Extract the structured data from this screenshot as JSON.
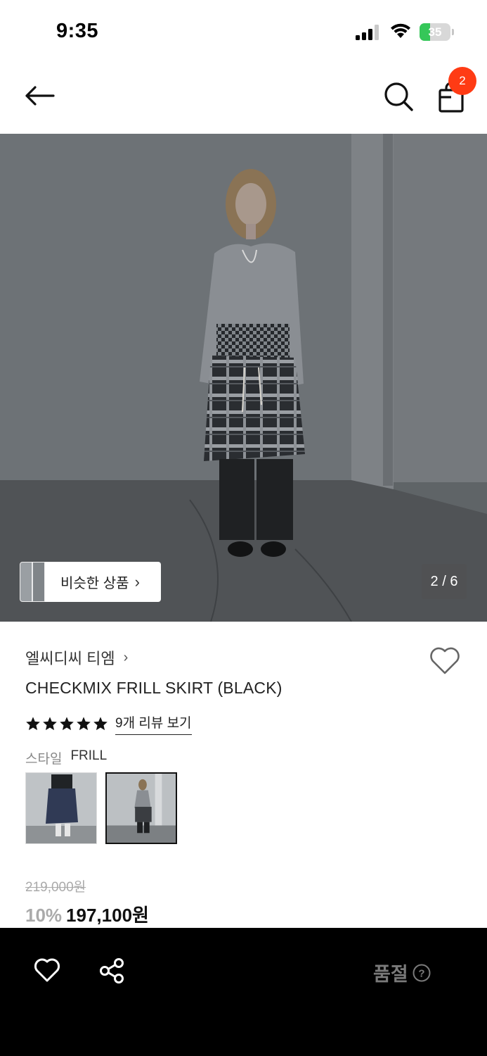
{
  "status_bar": {
    "time": "9:35",
    "battery_percent": "35",
    "battery_level": 0.35,
    "signal_bars": 3,
    "wifi": true
  },
  "nav": {
    "back_icon": "arrow-left-icon",
    "search_icon": "search-icon",
    "cart_icon": "shopping-bag-icon",
    "cart_count": "2"
  },
  "gallery": {
    "similar_label": "비슷한 상품",
    "similar_chevron": "›",
    "page_indicator": "2 / 6"
  },
  "product": {
    "brand": "엘씨디씨 티엠",
    "brand_chevron": "›",
    "name": "CHECKMIX FRILL SKIRT (BLACK)",
    "rating_stars": 5,
    "review_link": "9개 리뷰 보기",
    "style_label": "스타일",
    "style_value": "FRILL",
    "original_price": "219,000원",
    "discount": "10%",
    "sale_price": "197,100원"
  },
  "bottom_bar": {
    "wish_icon": "heart-outline-icon",
    "share_icon": "share-icon",
    "status_label": "품절",
    "help_icon": "question-circle-icon"
  },
  "colors": {
    "badge": "#ff3b14",
    "battery": "#35c759",
    "bottom_bar": "#000000"
  }
}
